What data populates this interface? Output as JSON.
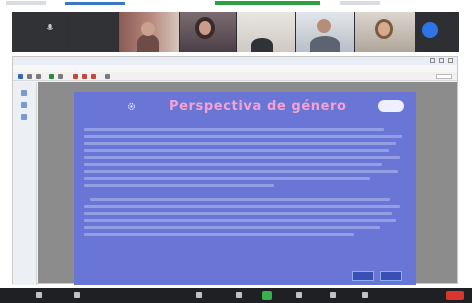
{
  "slide": {
    "title": "Perspectiva de género"
  },
  "colors": {
    "slide_background": "#6a76d6",
    "slide_title": "#f3a2d2",
    "call_background": "#2d2f33",
    "leave_button": "#d9352e",
    "active_control": "#35b34a"
  },
  "icons": [
    "microphone-icon",
    "gear-icon",
    "camera-icon",
    "share-screen-icon",
    "participants-icon",
    "chat-icon",
    "leave-icon"
  ]
}
